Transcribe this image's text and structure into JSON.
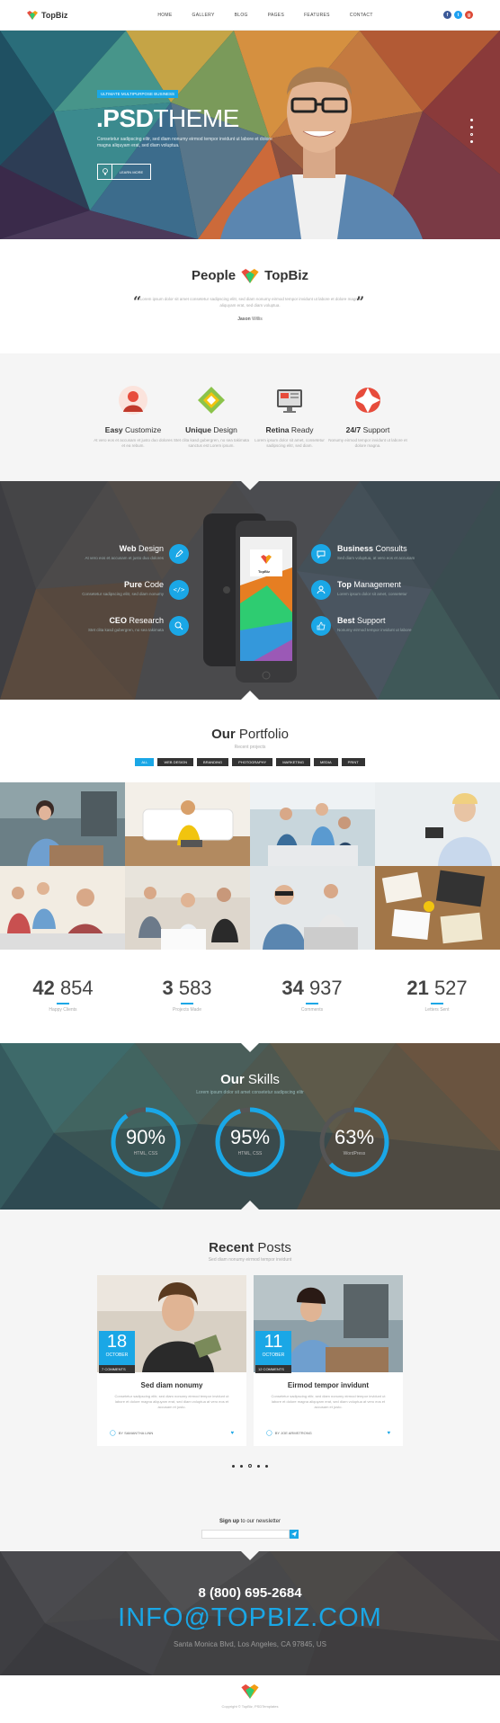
{
  "nav": {
    "brand": "TopBiz",
    "menu": [
      "HOME",
      "GALLERY",
      "BLOG",
      "PAGES",
      "FEATURES",
      "CONTACT"
    ],
    "social_icons": [
      "facebook-icon",
      "twitter-icon",
      "google-plus-icon"
    ]
  },
  "hero": {
    "badge": "ULTIMATE MULTIPURPOSE BUSINESS",
    "title_bold": ".PSD",
    "title_rest": "THEME",
    "text": "Consetetur sadipscing elitr, sed diam nonumy eirmod tempor invidunt ut labore et dolore magna aliquyam erat, sed diam voluptua.",
    "button": "LEARN MORE"
  },
  "testimonial": {
    "title_1": "People",
    "title_2": "TopBiz",
    "quote": "Lorem ipsum dolor sit amet consetetur sadipscing elitr, sed diam nonumy eirmod tempor invidunt ut labore et dolore magna aliquyam erat, sed diam voluptua.",
    "author": "Jason",
    "author_rest": "Willis"
  },
  "features": [
    {
      "bold": "Easy",
      "rest": "Customize",
      "text": "At vero eos et accusam et justo duo dolores et ea rebum."
    },
    {
      "bold": "Unique",
      "rest": "Design",
      "text": "Stet clita kasd gubergren, no sea takimata sanctus est Lorem ipsum."
    },
    {
      "bold": "Retina",
      "rest": "Ready",
      "text": "Lorem ipsum dolor sit amet, consetetur sadipscing elitr, sed diam."
    },
    {
      "bold": "24/7",
      "rest": "Support",
      "text": "Nonumy eirmod tempor invidunt ut labore et dolore magna."
    }
  ],
  "services": {
    "left": [
      {
        "bold": "Web",
        "rest": "Design",
        "sub": "At vero eos et accusam et justo duo dolores"
      },
      {
        "bold": "Pure",
        "rest": "Code",
        "sub": "Consetetur sadipscing elitr, sed diam nonumy"
      },
      {
        "bold": "CEO",
        "rest": "Research",
        "sub": "Stet clita kasd gubergren, no sea takimata"
      }
    ],
    "right": [
      {
        "bold": "Business",
        "rest": "Consults",
        "sub": "Sed diam voluptua, at vero eos et accusam"
      },
      {
        "bold": "Top",
        "rest": "Management",
        "sub": "Lorem ipsum dolor sit amet, consetetur"
      },
      {
        "bold": "Best",
        "rest": "Support",
        "sub": "Nonumy eirmod tempor invidunt ut labore"
      }
    ],
    "phone_brand": "TopBiz"
  },
  "portfolio": {
    "title_bold": "Our",
    "title_rest": "Portfolio",
    "sub": "Recent projects",
    "filters": [
      "ALL",
      "WEB DESIGN",
      "BRANDING",
      "PHOTOGRAPHY",
      "MARKETING",
      "MEDIA",
      "PRINT"
    ]
  },
  "stats": [
    {
      "bold": "42",
      "rest": "854",
      "label": "Happy Clients"
    },
    {
      "bold": "3",
      "rest": "583",
      "label": "Projects Made"
    },
    {
      "bold": "34",
      "rest": "937",
      "label": "Comments"
    },
    {
      "bold": "21",
      "rest": "527",
      "label": "Letters Sent"
    }
  ],
  "skills": {
    "title_bold": "Our",
    "title_rest": "Skills",
    "sub": "Lorem ipsum dolor sit amet consetetur sadipscing elitr",
    "items": [
      {
        "value": "90%",
        "fraction": 0.9,
        "label": "HTML, CSS"
      },
      {
        "value": "95%",
        "fraction": 0.95,
        "label": "HTML, CSS"
      },
      {
        "value": "63%",
        "fraction": 0.63,
        "label": "WordPress"
      }
    ]
  },
  "posts": {
    "title_bold": "Recent",
    "title_rest": "Posts",
    "sub": "Sed diam nonumy eirmod tempor invidunt",
    "items": [
      {
        "day": "18",
        "month": "OCTOBER",
        "comments": "7 COMMENTS",
        "title": "Sed diam nonumy",
        "text": "Consetetur sadipscing elitr, sed diam nonumy eirmod tempor invidunt ut labore et dolore magna aliquyam erat, sed diam voluptua at vero eos et accusam et justo.",
        "author": "BY SAMANTHA LINN"
      },
      {
        "day": "11",
        "month": "OCTOBER",
        "comments": "12 COMMENTS",
        "title": "Eirmod tempor invidunt",
        "text": "Consetetur sadipscing elitr, sed diam nonumy eirmod tempor invidunt ut labore et dolore magna aliquyam erat, sed diam voluptua at vero eos et accusam et justo.",
        "author": "BY JOE ARMSTRONG"
      }
    ]
  },
  "newsletter": {
    "bold": "Sign up",
    "rest": "to our newsletter"
  },
  "contact": {
    "phone": "8 (800) 695-2684",
    "email": "INFO@TOPBIZ.COM",
    "address": "Santa Monica Blvd, Los Angeles, CA 97845, US"
  },
  "footer": {
    "copyright": "Copyright © TopBiz, PSDTemplates"
  },
  "colors": {
    "accent": "#1aa7e6",
    "dark": "#333333"
  }
}
